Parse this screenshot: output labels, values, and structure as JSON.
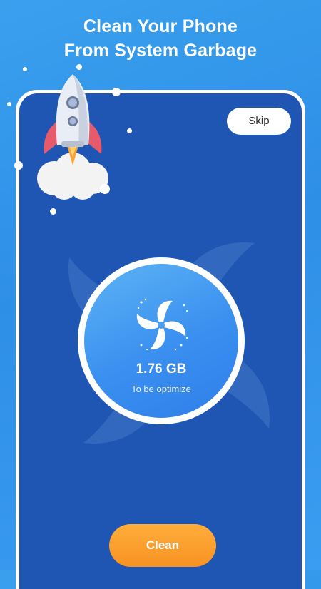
{
  "header": {
    "line1": "Clean Your Phone",
    "line2": "From System Garbage"
  },
  "phone": {
    "skip_label": "Skip",
    "storage": {
      "size": "1.76 GB",
      "caption": "To be optimize"
    },
    "clean_label": "Clean"
  },
  "icons": {
    "rocket": "rocket-icon",
    "fan": "fan-icon"
  },
  "colors": {
    "background": "#3aa0ee",
    "phone_screen": "#1f56b3",
    "accent_button": "#f79222",
    "circle": "#3a8ff0"
  }
}
